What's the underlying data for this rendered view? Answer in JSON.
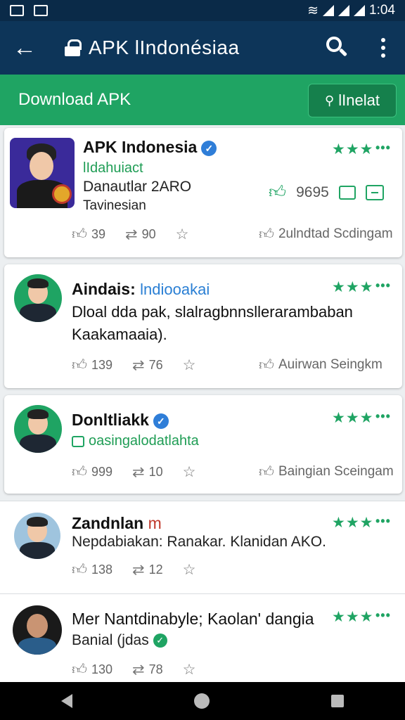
{
  "status_bar": {
    "time": "1:04"
  },
  "app_bar": {
    "title": "APK lIndonésiaa"
  },
  "download_bar": {
    "title": "Download APK",
    "install_label": "lInelat"
  },
  "header_card": {
    "name": "APK Indonesia",
    "link": "lIdahuiact",
    "line1": "Danautlar 2ARO",
    "line2": "Tavinesian",
    "likes_total": "9695",
    "stars": "★★★",
    "actions": {
      "likes": "39",
      "reposts": "90"
    },
    "right_action": "2ulndtad Scdingam"
  },
  "posts": [
    {
      "name": "Aindais:",
      "handle": "lndiooakai",
      "body": "Dloal dda pak, slalragbnnsllerarambaban Kaakamaaia).",
      "stars": "★★★",
      "likes": "139",
      "reposts": "76",
      "right_action": "Auirwan Seingkm"
    },
    {
      "name": "Donltliakk",
      "sub": "oasingalodatlahta",
      "stars": "★★★",
      "likes": "999",
      "reposts": "10",
      "right_action": "Baingian Sceingam"
    },
    {
      "name": "Zandnlan",
      "name_suffix": "m",
      "body": "Nepdabiakan: Ranakar. Klanidan AKO.",
      "stars": "★★★",
      "likes": "138",
      "reposts": "12"
    },
    {
      "name": "Mer Nantdinabyle; Kaolan' dangia",
      "body": "Banial (jdas",
      "stars": "★★★",
      "likes": "130",
      "reposts": "78"
    }
  ],
  "colors": {
    "app_bar": "#0d3559",
    "accent_green": "#1fa463",
    "verified_blue": "#2f7ed8"
  }
}
